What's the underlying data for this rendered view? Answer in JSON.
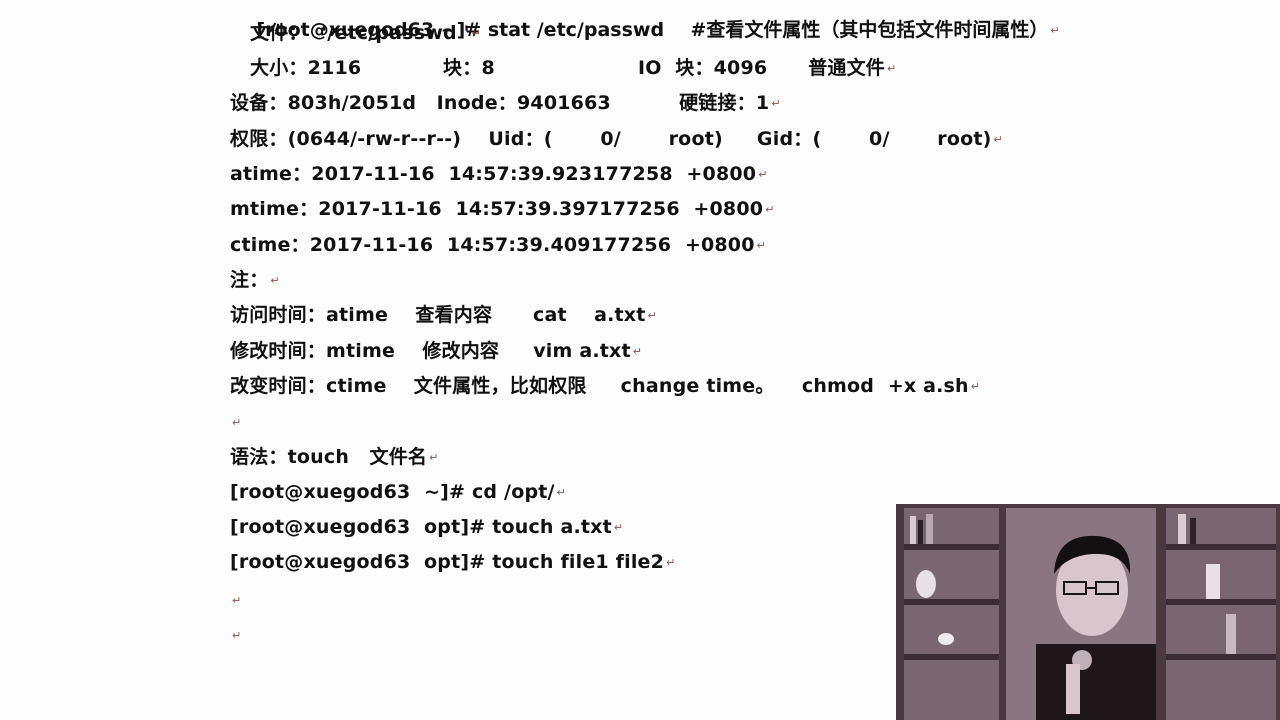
{
  "doc": {
    "top_partial": "[root@xuegod63 ~]# stat /etc/passwd    #查看文件属性（其中包括文件时间属性）",
    "lines": [
      "文件：  '/etc/passwd '",
      "大小：2116            块：8                     IO  块：4096      普通文件",
      "设备：803h/2051d   Inode：9401663          硬链接：1",
      "权限：(0644/-rw-r--r--)    Uid：(       0/       root)     Gid：(       0/       root)",
      "atime：2017-11-16  14:57:39.923177258  +0800",
      "mtime：2017-11-16  14:57:39.397177256  +0800",
      "ctime：2017-11-16  14:57:39.409177256  +0800",
      "注：",
      "访问时间：atime    查看内容      cat    a.txt",
      "修改时间：mtime    修改内容     vim a.txt",
      "改变时间：ctime    文件属性，比如权限     change time。    chmod  +x a.sh",
      "",
      "语法：touch   文件名",
      "[root@xuegod63  ~]# cd /opt/",
      "[root@xuegod63  opt]# touch a.txt",
      "[root@xuegod63  opt]# touch file1 file2",
      "",
      ""
    ],
    "paragraph_mark": "↵"
  },
  "colors": {
    "background": "#fdfdfd",
    "text": "#111111",
    "paragraph_mark": "#9a5050"
  }
}
